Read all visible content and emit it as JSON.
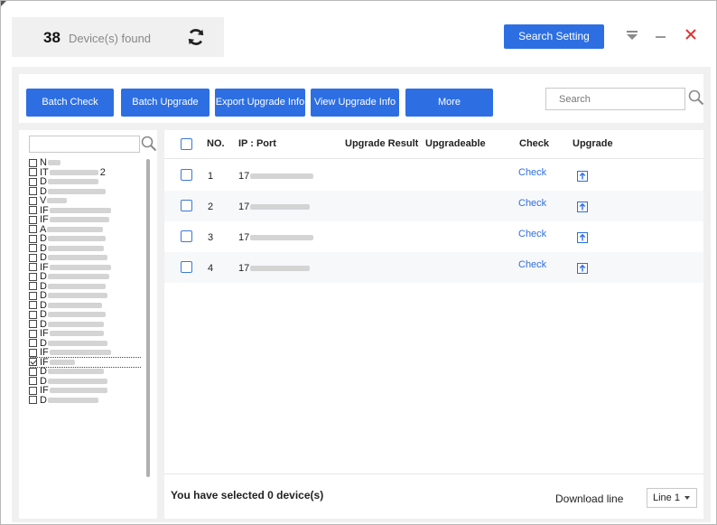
{
  "header": {
    "count": "38",
    "count_label": "Device(s) found",
    "search_setting_label": "Search Setting"
  },
  "toolbar": {
    "buttons": [
      "Batch Check",
      "Batch Upgrade",
      "Export Upgrade Info",
      "View Upgrade Info",
      "More"
    ],
    "search_placeholder": "Search"
  },
  "device_tree": {
    "items": [
      {
        "label": "N",
        "checked": false
      },
      {
        "label": "IT",
        "suffix": "2",
        "checked": false
      },
      {
        "label": "D",
        "checked": false
      },
      {
        "label": "D",
        "checked": false
      },
      {
        "label": "V",
        "checked": false
      },
      {
        "label": "IF",
        "checked": false
      },
      {
        "label": "IF",
        "checked": false
      },
      {
        "label": "A",
        "checked": false
      },
      {
        "label": "D",
        "checked": false
      },
      {
        "label": "D",
        "checked": false
      },
      {
        "label": "D",
        "checked": false
      },
      {
        "label": "IF",
        "checked": false
      },
      {
        "label": "D",
        "checked": false
      },
      {
        "label": "D",
        "checked": false
      },
      {
        "label": "D",
        "checked": false
      },
      {
        "label": "D",
        "checked": false
      },
      {
        "label": "D",
        "checked": false
      },
      {
        "label": "D",
        "checked": false
      },
      {
        "label": "IF",
        "checked": false
      },
      {
        "label": "D",
        "checked": false
      },
      {
        "label": "IF",
        "checked": false
      },
      {
        "label": "IF",
        "checked": true
      },
      {
        "label": "D",
        "checked": false
      },
      {
        "label": "D",
        "checked": false
      },
      {
        "label": "IF",
        "checked": false
      },
      {
        "label": "D",
        "checked": false
      }
    ]
  },
  "table": {
    "columns": [
      "NO.",
      "IP : Port",
      "Upgrade Result",
      "Upgradeable",
      "Check",
      "Upgrade"
    ],
    "rows": [
      {
        "no": "1",
        "ip": "17",
        "check": "Check"
      },
      {
        "no": "2",
        "ip": "17",
        "check": "Check"
      },
      {
        "no": "3",
        "ip": "17",
        "check": "Check"
      },
      {
        "no": "4",
        "ip": "17",
        "check": "Check"
      }
    ]
  },
  "footer": {
    "selected_text": "You have selected 0  device(s)",
    "download_label": "Download line",
    "download_value": "Line 1"
  },
  "colors": {
    "accent": "#2d6fe3",
    "close": "#e0322f"
  }
}
